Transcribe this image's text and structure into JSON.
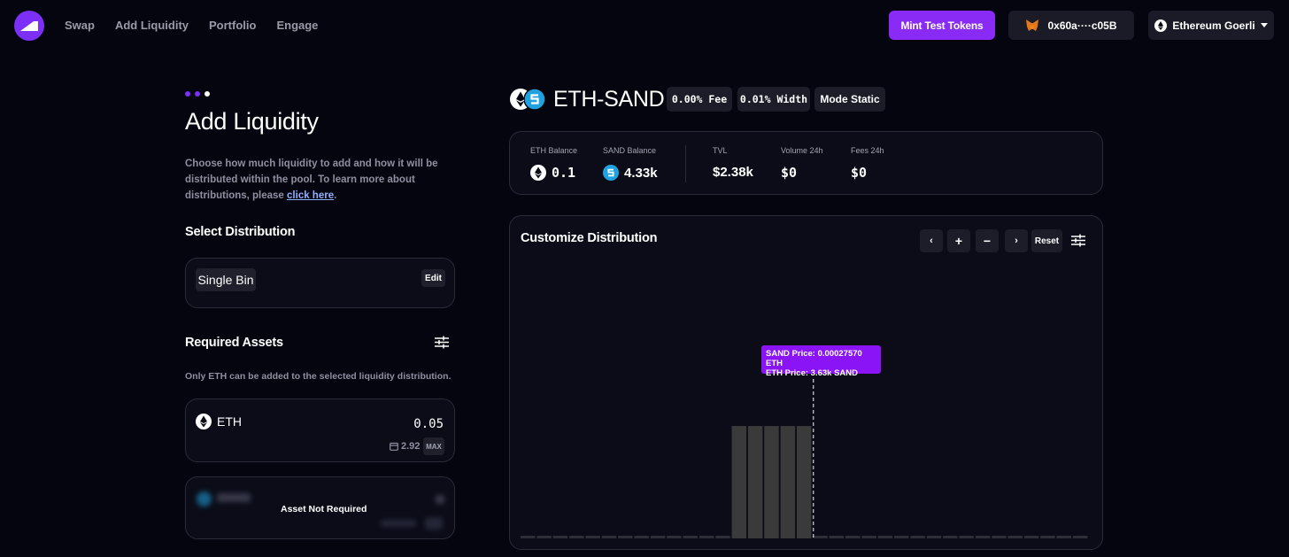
{
  "header": {
    "nav": [
      "Swap",
      "Add Liquidity",
      "Portfolio",
      "Engage"
    ],
    "mint_label": "Mint Test Tokens",
    "wallet_label": "0x60a····c05B",
    "network_label": "Ethereum Goerli"
  },
  "left": {
    "title": "Add Liquidity",
    "description_text": "Choose how much liquidity to add and how it will be distributed within the pool. To learn more about distributions, please",
    "description_link": "click here",
    "description_end": ".",
    "select_distribution_heading": "Select Distribution",
    "distribution_value": "Single Bin",
    "edit_label": "Edit",
    "required_assets_heading": "Required Assets",
    "required_assets_note": "Only ETH can be added to the selected liquidity distribution.",
    "eth_asset": {
      "symbol": "ETH",
      "amount": "0.05",
      "balance": "2.92",
      "max_label": "MAX"
    },
    "sand_asset": {
      "status": "Asset Not Required"
    }
  },
  "pool": {
    "name": "ETH-SAND",
    "fee": "0.00% Fee",
    "width": "0.01% Width",
    "mode": "Mode Static"
  },
  "stats": {
    "eth_balance_label": "ETH Balance",
    "eth_balance": "0.1",
    "sand_balance_label": "SAND Balance",
    "sand_balance": "4.33k",
    "tvl_label": "TVL",
    "tvl": "$2.38k",
    "volume_label": "Volume 24h",
    "volume": "$0",
    "fees_label": "Fees 24h",
    "fees": "$0"
  },
  "chart": {
    "title": "Customize Distribution",
    "controls": [
      "‹",
      "+",
      "−",
      "›"
    ],
    "reset_label": "Reset",
    "tooltip_line1": "SAND Price:  0.00027570 ETH",
    "tooltip_line2": "ETH Price:  3.63k SAND"
  },
  "chart_data": {
    "type": "bar",
    "title": "Customize Distribution",
    "bin_count": 35,
    "active_bin_index": 18,
    "values": [
      0,
      0,
      0,
      0,
      0,
      0,
      0,
      0,
      0,
      0,
      0,
      0,
      0,
      1,
      1,
      1,
      1,
      1,
      0,
      0,
      0,
      0,
      0,
      0,
      0,
      0,
      0,
      0,
      0,
      0,
      0,
      0,
      0,
      0,
      0
    ],
    "ylim": [
      0,
      1.3
    ]
  },
  "colors": {
    "accent": "#8a2bf5",
    "background": "#05050f",
    "card": "#0b0c18",
    "bar": "#3a3a3a"
  }
}
